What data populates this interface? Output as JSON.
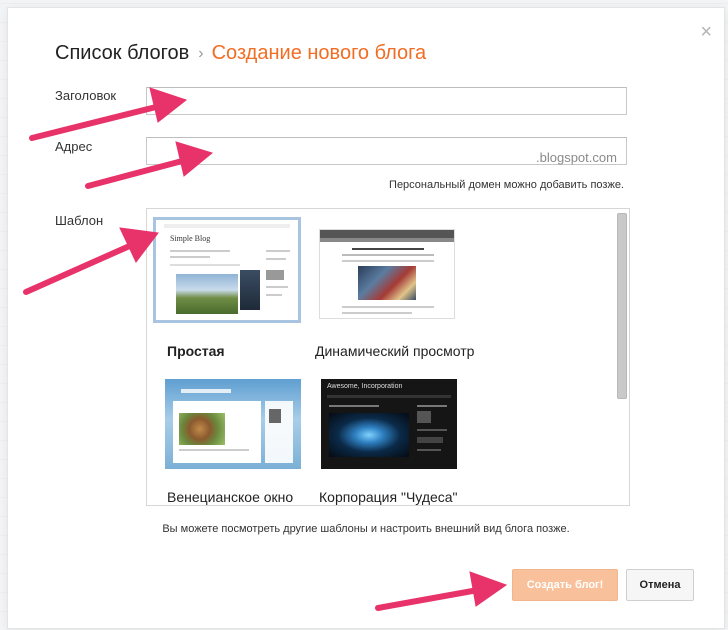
{
  "dialog": {
    "breadcrumb_root": "Список блогов",
    "breadcrumb_separator": "›",
    "breadcrumb_current": "Создание нового блога",
    "close_glyph": "×"
  },
  "form": {
    "title_label": "Заголовок",
    "title_value": "",
    "address_label": "Адрес",
    "address_value": "",
    "address_suffix": ".blogspot.com",
    "domain_hint": "Персональный домен можно добавить позже.",
    "template_label": "Шаблон"
  },
  "templates": [
    {
      "name": "Простая",
      "selected": true
    },
    {
      "name": "Динамический просмотр",
      "selected": false
    },
    {
      "name": "Венецианское окно",
      "selected": false
    },
    {
      "name": "Корпорация \"Чудеса\"",
      "selected": false
    }
  ],
  "thumbnails": {
    "simple_blog_title": "Simple Blog",
    "corp_title": "Awesome, Incorporation"
  },
  "footer": {
    "hint": "Вы можете посмотреть другие шаблоны и настроить внешний вид блога позже.",
    "create_label": "Создать блог!",
    "cancel_label": "Отмена"
  },
  "colors": {
    "accent": "#f26d24",
    "annotation_arrow": "#e8336a",
    "create_button": "#f8c19b"
  }
}
